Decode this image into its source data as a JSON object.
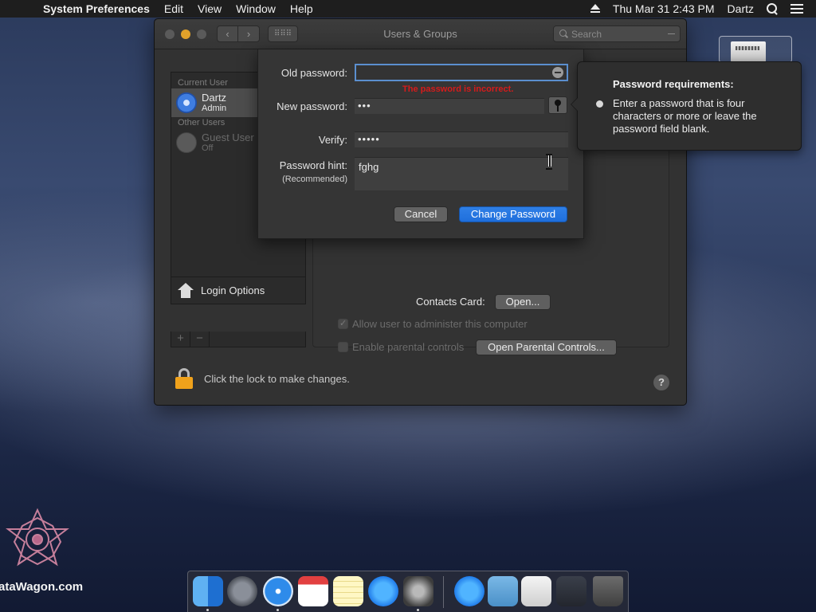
{
  "menubar": {
    "apple_glyph": "",
    "app_name": "System Preferences",
    "menus": [
      "Edit",
      "View",
      "Window",
      "Help"
    ],
    "clock": "Thu Mar 31  2:43 PM",
    "user": "Dartz"
  },
  "window": {
    "title": "Users & Groups",
    "nav_back": "‹",
    "nav_forward": "›",
    "grid_glyph": "⠿⠿⠿",
    "search_placeholder": "Search"
  },
  "sidebar": {
    "current_header": "Current User",
    "current_user": {
      "name": "Dartz",
      "role": "Admin"
    },
    "other_header": "Other Users",
    "guest_user": {
      "name": "Guest User",
      "role": "Off"
    },
    "login_options": "Login Options",
    "plus": "+",
    "minus": "−"
  },
  "panel": {
    "contacts_label": "Contacts Card:",
    "open_button": "Open...",
    "allow_admin": "Allow user to administer this computer",
    "allow_admin_checked": true,
    "parental_label": "Enable parental controls",
    "parental_checked": false,
    "open_parental_button": "Open Parental Controls..."
  },
  "lock": {
    "text": "Click the lock to make changes.",
    "help": "?"
  },
  "sheet": {
    "old_password_label": "Old password:",
    "old_password_value": "",
    "error_message": "The password is incorrect.",
    "new_password_label": "New password:",
    "new_password_value": "•••",
    "verify_label": "Verify:",
    "verify_value": "•••••",
    "hint_label": "Password hint:",
    "hint_sublabel": "(Recommended)",
    "hint_value": "fghg",
    "cancel": "Cancel",
    "change": "Change Password"
  },
  "popover": {
    "title": "Password requirements:",
    "requirement": "Enter a password that is four characters or more or leave the password field blank."
  },
  "watermark": {
    "text": "ataWagon.com"
  },
  "colors": {
    "accent": "#1f6fdc",
    "error": "#d51b1b",
    "lock": "#f0a21b"
  }
}
